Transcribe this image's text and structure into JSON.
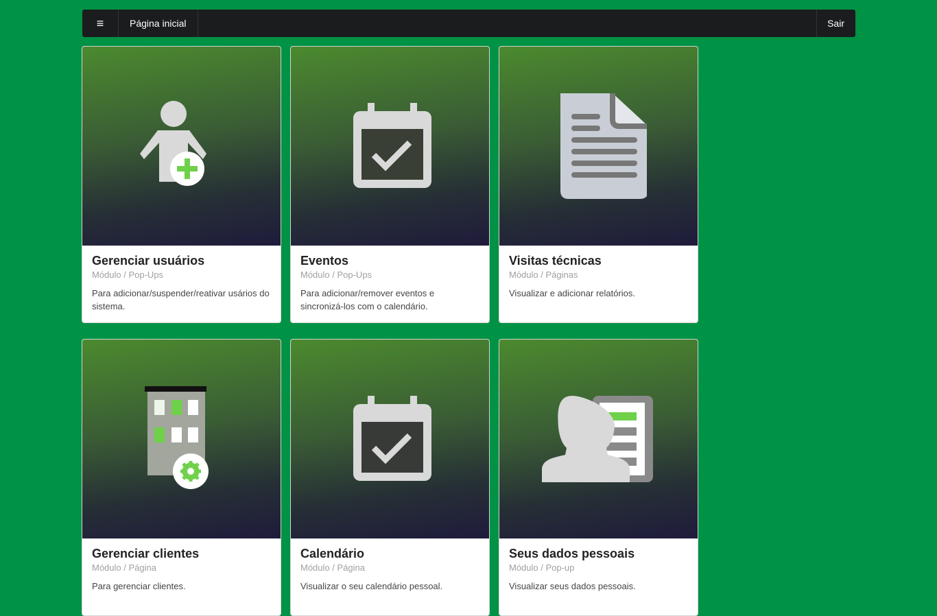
{
  "navbar": {
    "menu_icon": "≡",
    "home_label": "Página inicial",
    "logout_label": "Sair"
  },
  "cards": [
    {
      "title": "Gerenciar usuários",
      "meta": "Módulo / Pop-Ups",
      "description": "Para adicionar/suspender/reativar usários do sistema.",
      "icon": "add-user-icon"
    },
    {
      "title": "Eventos",
      "meta": "Módulo / Pop-Ups",
      "description": "Para adicionar/remover eventos e sincronizá-los com o calendário.",
      "icon": "calendar-check-icon"
    },
    {
      "title": "Visitas técnicas",
      "meta": "Módulo / Páginas",
      "description": "Visualizar e adicionar relatórios.",
      "icon": "document-icon"
    },
    {
      "title": "Gerenciar clientes",
      "meta": "Módulo / Página",
      "description": "Para gerenciar clientes.",
      "icon": "building-settings-icon"
    },
    {
      "title": "Calendário",
      "meta": "Módulo / Página",
      "description": "Visualizar o seu calendário pessoal.",
      "icon": "calendar-check-icon"
    },
    {
      "title": "Seus dados pessoais",
      "meta": "Módulo / Pop-up",
      "description": "Visualizar seus dados pessoais.",
      "icon": "personal-data-icon"
    }
  ],
  "colors": {
    "background": "#009245",
    "navbar": "#1b1c1d",
    "accent_green": "#6fd04a",
    "icon_gray": "#d9d9d9"
  }
}
